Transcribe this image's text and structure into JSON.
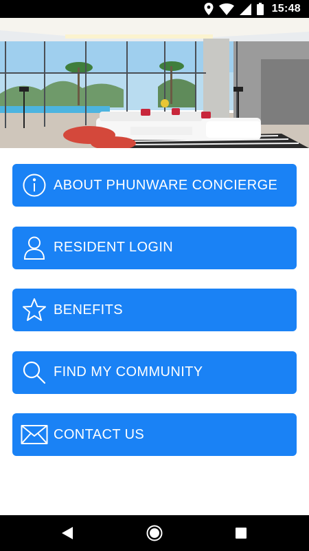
{
  "status_bar": {
    "time": "15:48",
    "icons": [
      "location-icon",
      "wifi-icon",
      "signal-icon",
      "battery-icon"
    ]
  },
  "hero": {
    "image": "luxury-apartment-living-room-photo"
  },
  "menu": {
    "items": [
      {
        "label": "ABOUT PHUNWARE CONCIERGE",
        "icon": "info-icon"
      },
      {
        "label": "RESIDENT LOGIN",
        "icon": "user-icon"
      },
      {
        "label": "BENEFITS",
        "icon": "star-icon"
      },
      {
        "label": "FIND MY COMMUNITY",
        "icon": "search-icon"
      },
      {
        "label": "CONTACT US",
        "icon": "envelope-icon"
      }
    ]
  },
  "nav_bar": {
    "buttons": [
      "back-icon",
      "home-icon",
      "recents-icon"
    ]
  },
  "colors": {
    "button_blue": "#1a82f5",
    "status_bar": "#000000",
    "nav_bar": "#000000"
  }
}
